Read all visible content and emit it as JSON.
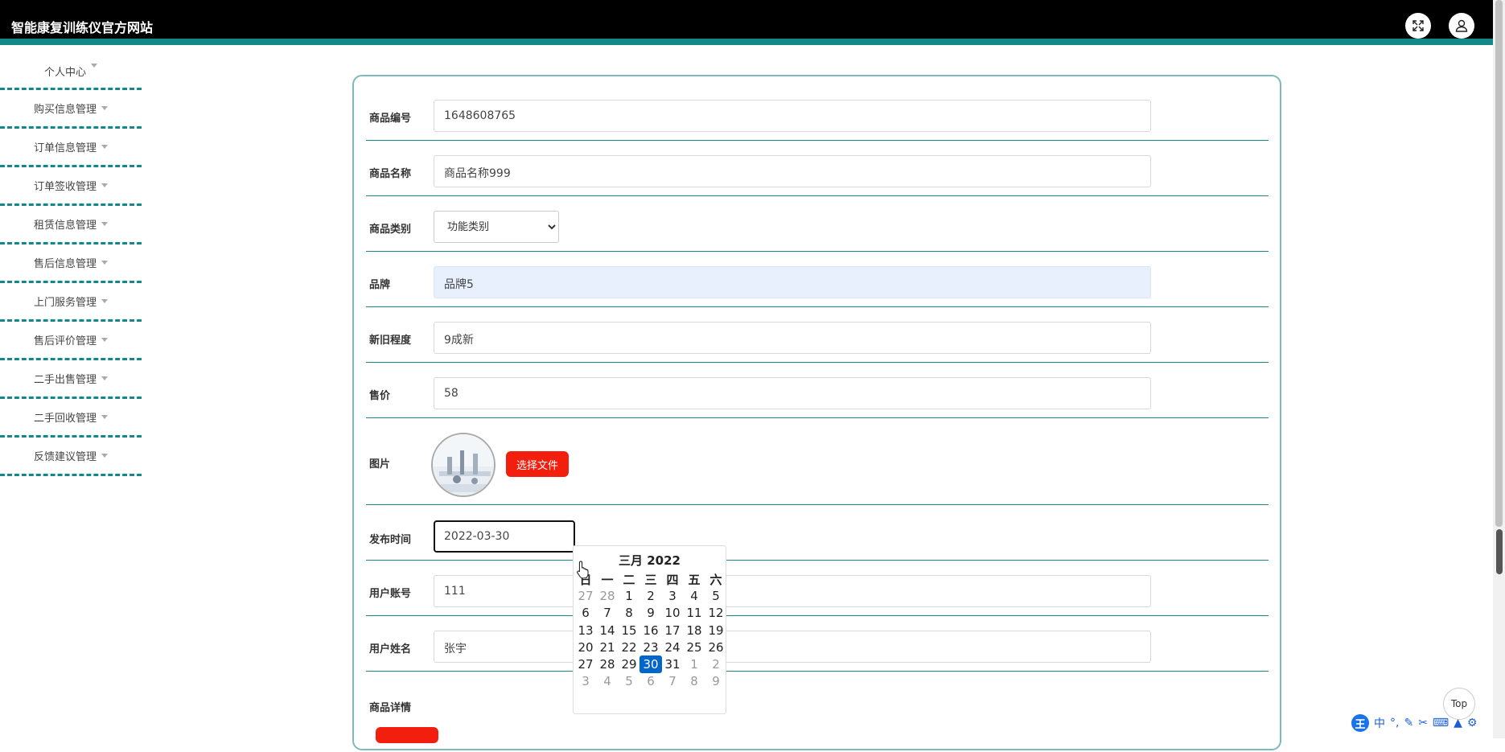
{
  "header": {
    "title": "智能康复训练仪官方网站",
    "fullscreen_icon": "expand-icon",
    "user_icon": "user-icon"
  },
  "sidebar": {
    "items": [
      {
        "label": "个人中心"
      },
      {
        "label": "购买信息管理"
      },
      {
        "label": "订单信息管理"
      },
      {
        "label": "订单签收管理"
      },
      {
        "label": "租赁信息管理"
      },
      {
        "label": "售后信息管理"
      },
      {
        "label": "上门服务管理"
      },
      {
        "label": "售后评价管理"
      },
      {
        "label": "二手出售管理"
      },
      {
        "label": "二手回收管理"
      },
      {
        "label": "反馈建议管理"
      }
    ]
  },
  "form": {
    "product_no": {
      "label": "商品编号",
      "value": "1648608765"
    },
    "product_name": {
      "label": "商品名称",
      "value": "商品名称999"
    },
    "category": {
      "label": "商品类别",
      "value": "功能类别"
    },
    "brand": {
      "label": "品牌",
      "value": "品牌5"
    },
    "condition": {
      "label": "新旧程度",
      "value": "9成新"
    },
    "price": {
      "label": "售价",
      "value": "58"
    },
    "image": {
      "label": "图片",
      "button": "选择文件"
    },
    "publish_time": {
      "label": "发布时间",
      "value": "2022-03-30"
    },
    "user_account": {
      "label": "用户账号",
      "value": "111"
    },
    "user_name": {
      "label": "用户姓名",
      "value": "张宇"
    },
    "details": {
      "label": "商品详情"
    }
  },
  "datepicker": {
    "caption": "三月 2022",
    "weekdays": [
      "日",
      "一",
      "二",
      "三",
      "四",
      "五",
      "六"
    ],
    "weeks": [
      [
        {
          "d": "27",
          "m": true
        },
        {
          "d": "28",
          "m": true
        },
        {
          "d": "1"
        },
        {
          "d": "2"
        },
        {
          "d": "3"
        },
        {
          "d": "4"
        },
        {
          "d": "5"
        }
      ],
      [
        {
          "d": "6"
        },
        {
          "d": "7"
        },
        {
          "d": "8"
        },
        {
          "d": "9"
        },
        {
          "d": "10"
        },
        {
          "d": "11"
        },
        {
          "d": "12"
        }
      ],
      [
        {
          "d": "13"
        },
        {
          "d": "14"
        },
        {
          "d": "15"
        },
        {
          "d": "16"
        },
        {
          "d": "17"
        },
        {
          "d": "18"
        },
        {
          "d": "19"
        }
      ],
      [
        {
          "d": "20"
        },
        {
          "d": "21"
        },
        {
          "d": "22"
        },
        {
          "d": "23"
        },
        {
          "d": "24"
        },
        {
          "d": "25"
        },
        {
          "d": "26"
        }
      ],
      [
        {
          "d": "27"
        },
        {
          "d": "28"
        },
        {
          "d": "29"
        },
        {
          "d": "30",
          "sel": true
        },
        {
          "d": "31"
        },
        {
          "d": "1",
          "m": true
        },
        {
          "d": "2",
          "m": true
        }
      ],
      [
        {
          "d": "3",
          "m": true
        },
        {
          "d": "4",
          "m": true
        },
        {
          "d": "5",
          "m": true
        },
        {
          "d": "6",
          "m": true
        },
        {
          "d": "7",
          "m": true
        },
        {
          "d": "8",
          "m": true
        },
        {
          "d": "9",
          "m": true
        }
      ]
    ]
  },
  "top_button": "Top",
  "ime": {
    "logo": "王",
    "mode": "中"
  },
  "colors": {
    "accent": "#138888",
    "danger": "#f21f0f",
    "selected": "#0066cc"
  }
}
